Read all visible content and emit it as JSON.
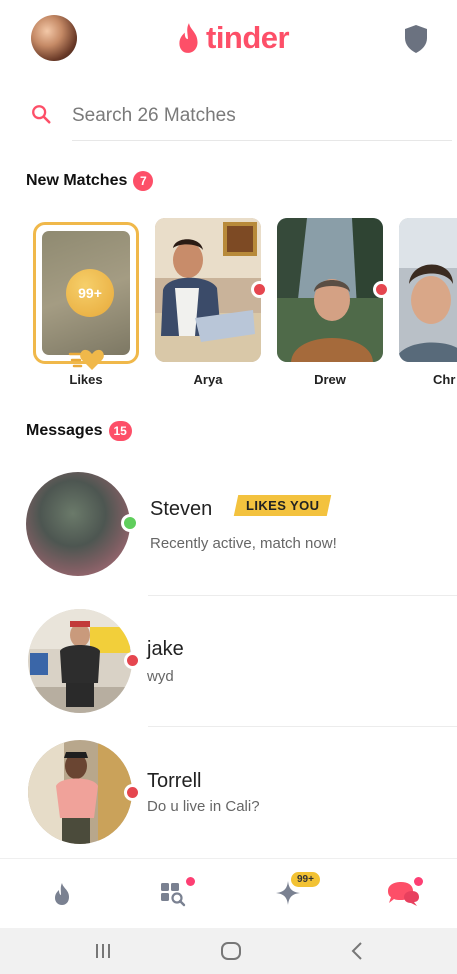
{
  "brand": {
    "name": "tinder",
    "color": "#fd4f68"
  },
  "search": {
    "placeholder": "Search 26 Matches"
  },
  "new_matches": {
    "title": "New Matches",
    "count": "7",
    "likes": {
      "label": "Likes",
      "count": "99+"
    },
    "items": [
      {
        "name": "Arya"
      },
      {
        "name": "Drew"
      },
      {
        "name": "Chr"
      }
    ]
  },
  "messages": {
    "title": "Messages",
    "count": "15",
    "items": [
      {
        "name": "Steven",
        "badge": "LIKES YOU",
        "preview": "Recently active, match now!",
        "status": "online-green"
      },
      {
        "name": "jake",
        "preview": "wyd",
        "status": "online-red"
      },
      {
        "name": "Torrell",
        "preview": "Do u live in Cali?",
        "status": "online-red"
      }
    ]
  },
  "tabbar": {
    "tabs": [
      {
        "icon": "flame-icon"
      },
      {
        "icon": "explore-icon"
      },
      {
        "icon": "sparkle-icon",
        "badge": "99+"
      },
      {
        "icon": "chat-icon"
      }
    ]
  },
  "colors": {
    "accent": "#fd4f68",
    "gold": "#f3c23e",
    "online_green": "#5fce5c",
    "online_red": "#e5464f"
  }
}
